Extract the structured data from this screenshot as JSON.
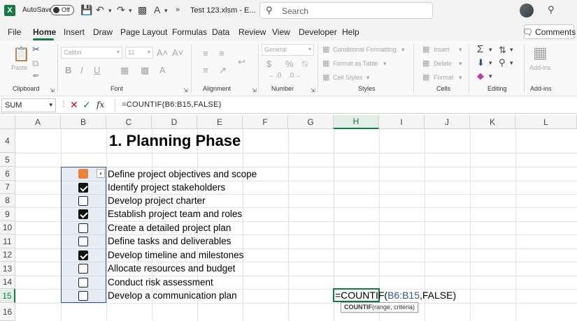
{
  "titlebar": {
    "autosave_label": "AutoSave",
    "autosave_state": "Off",
    "filename": "Test 123.xlsm  -  E...",
    "search_placeholder": "Search"
  },
  "menu": {
    "tabs": [
      "File",
      "Home",
      "Insert",
      "Draw",
      "Page Layout",
      "Formulas",
      "Data",
      "Review",
      "View",
      "Developer",
      "Help"
    ],
    "active": "Home",
    "comments_label": "Comments"
  },
  "ribbon": {
    "clipboard": {
      "paste": "Paste",
      "label": "Clipboard"
    },
    "font": {
      "name": "Calibri",
      "size": "11",
      "label": "Font"
    },
    "alignment": {
      "label": "Alignment"
    },
    "number": {
      "format": "General",
      "currency": "$",
      "percent": "%",
      "label": "Number"
    },
    "styles": {
      "conditional": "Conditional Formatting",
      "table": "Format as Table",
      "cell_styles": "Cell Styles",
      "label": "Styles"
    },
    "cells": {
      "insert": "Insert",
      "delete": "Delete",
      "format": "Format",
      "label": "Cells"
    },
    "editing": {
      "label": "Editing"
    },
    "addins": {
      "button": "Add-ins",
      "label": "Add-ins"
    }
  },
  "formula_bar": {
    "name_box": "SUM",
    "fx": "fx",
    "formula": "=COUNTIF(B6:B15,FALSE)"
  },
  "grid": {
    "columns": [
      "A",
      "B",
      "C",
      "D",
      "E",
      "F",
      "G",
      "H",
      "I",
      "J",
      "K",
      "L"
    ],
    "selected_column": "H",
    "rows": [
      "4",
      "5",
      "6",
      "7",
      "8",
      "9",
      "10",
      "11",
      "12",
      "13",
      "14",
      "15",
      "16"
    ],
    "selected_row": "15",
    "heading": "1. Planning Phase",
    "tasks": [
      {
        "text": "Define project objectives and scope",
        "checked": true
      },
      {
        "text": "Identify project stakeholders",
        "checked": true
      },
      {
        "text": "Develop project charter",
        "checked": false
      },
      {
        "text": "Establish project team and roles",
        "checked": true
      },
      {
        "text": "Create a detailed project plan",
        "checked": false
      },
      {
        "text": "Define tasks and deliverables",
        "checked": false
      },
      {
        "text": "Develop timeline and milestones",
        "checked": true
      },
      {
        "text": "Allocate resources and budget",
        "checked": false
      },
      {
        "text": "Conduct risk assessment",
        "checked": false
      },
      {
        "text": "Develop a communication plan",
        "checked": false
      }
    ],
    "active_cell": {
      "ref": "H15",
      "prefix": "=COUNTIF(",
      "range": "B6:B15",
      "suffix": ",FALSE)"
    },
    "tooltip": {
      "fn": "COUNTIF",
      "args": "(range, criteria)"
    }
  },
  "colors": {
    "excel_green": "#107c41",
    "checkbox_orange": "#e6843e",
    "range_blue": "#2f5597"
  }
}
